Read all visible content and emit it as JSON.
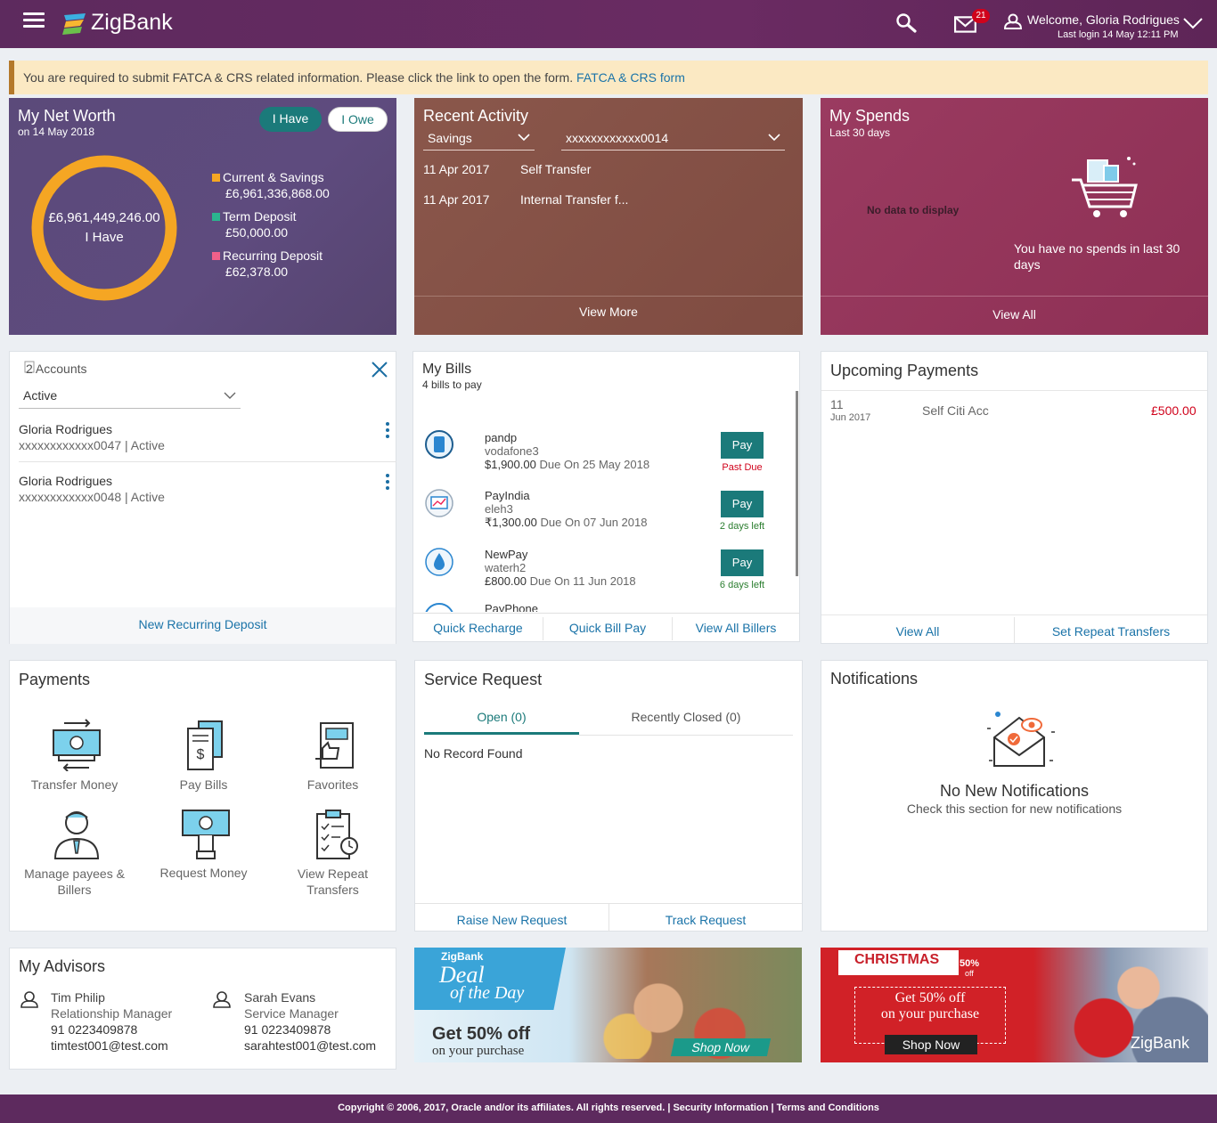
{
  "header": {
    "brand": "ZigBank",
    "welcome": "Welcome, Gloria Rodrigues",
    "last_login": "Last login 14 May 12:11 PM",
    "mail_count": "21",
    "icons": [
      "menu-icon",
      "search-icon",
      "mail-icon",
      "user-icon",
      "chevron-down-icon"
    ]
  },
  "alert": {
    "text": "You are required to submit FATCA & CRS related information. Please click the link to open the form.",
    "link": "FATCA & CRS form"
  },
  "net_worth": {
    "title": "My Net Worth",
    "subtitle": "on 14 May 2018",
    "tab_have": "I Have",
    "tab_owe": "I Owe",
    "total": "£6,961,449,246.00",
    "total_label": "I Have",
    "items": [
      {
        "label": "Current & Savings",
        "value": "£6,961,336,868.00",
        "color": "#f5a623"
      },
      {
        "label": "Term Deposit",
        "value": "£50,000.00",
        "color": "#2bb58f"
      },
      {
        "label": "Recurring Deposit",
        "value": "£62,378.00",
        "color": "#f0608a"
      }
    ]
  },
  "recent_activity": {
    "title": "Recent Activity",
    "account_type": "Savings",
    "account_no": "xxxxxxxxxxxx0014",
    "rows": [
      {
        "date": "11 Apr 2017",
        "desc": "Self Transfer"
      },
      {
        "date": "11 Apr 2017",
        "desc": "Internal Transfer f..."
      }
    ],
    "view_more": "View More"
  },
  "spends": {
    "title": "My Spends",
    "subtitle": "Last 30 days",
    "no_data": "No data to display",
    "message": "You have no spends in last 30 days",
    "view_all": "View All"
  },
  "accounts": {
    "title": "2 Accounts",
    "filter": "Active",
    "rows": [
      {
        "name": "Gloria Rodrigues",
        "detail": "xxxxxxxxxxxx0047 | Active"
      },
      {
        "name": "Gloria Rodrigues",
        "detail": "xxxxxxxxxxxx0048 | Active"
      }
    ],
    "action": "New Recurring Deposit"
  },
  "bills": {
    "title": "My Bills",
    "subtitle": "4 bills to pay",
    "rows": [
      {
        "biller": "pandp",
        "nick": "vodafone3",
        "amount": "$1,900.00",
        "due": "Due On 25 May 2018",
        "status": "Past Due",
        "status_color": "#d0021b",
        "pay": "Pay"
      },
      {
        "biller": "PayIndia",
        "nick": "eleh3",
        "amount": "₹1,300.00",
        "due": "Due On 07 Jun 2018",
        "status": "2 days left",
        "status_color": "#2a7d2e",
        "pay": "Pay"
      },
      {
        "biller": "NewPay",
        "nick": "waterh2",
        "amount": "£800.00",
        "due": "Due On 11 Jun 2018",
        "status": "6 days left",
        "status_color": "#2a7d2e",
        "pay": "Pay"
      },
      {
        "biller": "PayPhone"
      }
    ],
    "actions": [
      "Quick Recharge",
      "Quick Bill Pay",
      "View All Billers"
    ]
  },
  "upcoming": {
    "title": "Upcoming Payments",
    "day": "11",
    "month_year": "Jun  2017",
    "payee": "Self Citi Acc",
    "amount": "£500.00",
    "actions": [
      "View All",
      "Set Repeat Transfers"
    ]
  },
  "payments": {
    "title": "Payments",
    "items": [
      "Transfer Money",
      "Pay Bills",
      "Favorites",
      "Manage payees & Billers",
      "Request Money",
      "View Repeat Transfers"
    ]
  },
  "service": {
    "title": "Service Request",
    "tab_open": "Open (0)",
    "tab_closed": "Recently Closed (0)",
    "empty": "No Record Found",
    "actions": [
      "Raise New Request",
      "Track Request"
    ]
  },
  "notifications": {
    "title": "Notifications",
    "heading": "No New Notifications",
    "text": "Check this section for new notifications"
  },
  "advisors": {
    "title": "My Advisors",
    "list": [
      {
        "name": "Tim Philip",
        "role": "Relationship Manager",
        "phone": "91 0223409878",
        "email": "timtest001@test.com"
      },
      {
        "name": "Sarah Evans",
        "role": "Service Manager",
        "phone": "91 0223409878",
        "email": "sarahtest001@test.com"
      }
    ]
  },
  "banner1": {
    "brand": "ZigBank",
    "line1": "Deal",
    "line2": "of the Day",
    "offer": "Get 50% off",
    "sub": "on your purchase",
    "cta": "Shop Now"
  },
  "banner2": {
    "title": "CHRISTMAS",
    "pct": "50%",
    "off": "off",
    "offer": "Get 50% off",
    "sub": "on your purchase",
    "cta": "Shop Now",
    "brand": "ZigBank"
  },
  "footer": {
    "text": "Copyright © 2006, 2017, Oracle and/or its affiliates. All rights reserved. | Security Information | Terms and Conditions"
  }
}
